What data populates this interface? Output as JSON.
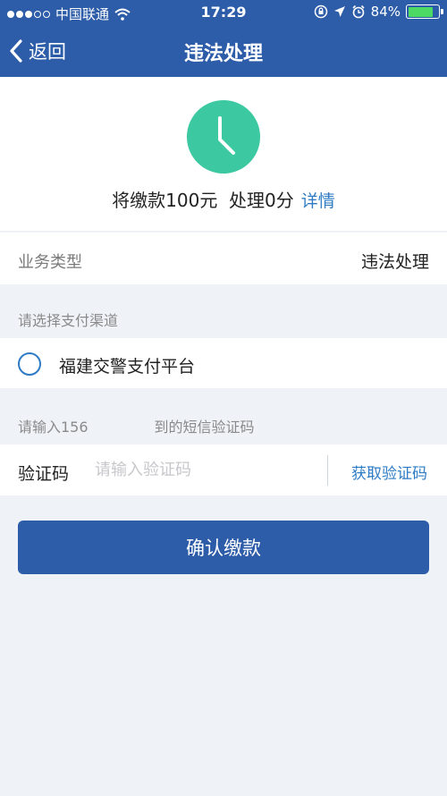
{
  "status_bar": {
    "carrier": "中国联通",
    "time": "17:29",
    "battery_percent": "84%",
    "battery_level": 0.84,
    "icons": [
      "wifi-icon",
      "rotation-lock-icon",
      "location-arrow-icon",
      "alarm-icon",
      "battery-icon"
    ]
  },
  "nav": {
    "back_label": "返回",
    "title": "违法处理"
  },
  "summary": {
    "icon": "clock-icon",
    "text": "将缴款100元  处理0分",
    "detail_link": "详情"
  },
  "business_type": {
    "label": "业务类型",
    "value": "违法处理"
  },
  "payment": {
    "section_label": "请选择支付渠道",
    "option": "福建交警支付平台"
  },
  "sms": {
    "section_label": "请输入156",
    "section_label_suffix": "到的短信验证码",
    "field_label": "验证码",
    "placeholder": "请输入验证码",
    "get_code": "获取验证码"
  },
  "confirm_button": "确认缴款",
  "colors": {
    "primary": "#2d5ca8",
    "accent": "#3cc8a1",
    "link": "#2e7bc4",
    "background": "#eff3f8"
  }
}
